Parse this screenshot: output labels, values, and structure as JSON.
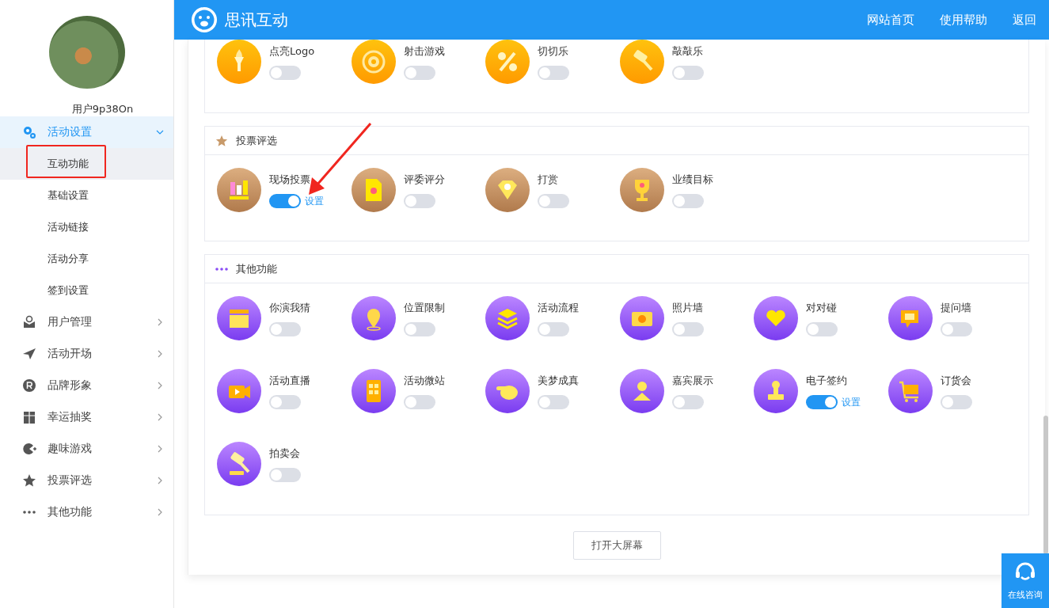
{
  "header": {
    "brand": "思讯互动",
    "links": [
      "网站首页",
      "使用帮助",
      "返回"
    ]
  },
  "sidebar": {
    "username": "用户9p38On",
    "menu": [
      {
        "label": "活动设置",
        "expanded": true,
        "children": [
          {
            "label": "互动功能",
            "selected": true,
            "highlighted": true
          },
          {
            "label": "基础设置",
            "selected": false,
            "highlighted": false
          },
          {
            "label": "活动链接",
            "selected": false,
            "highlighted": false
          },
          {
            "label": "活动分享",
            "selected": false,
            "highlighted": false
          },
          {
            "label": "签到设置",
            "selected": false,
            "highlighted": false
          }
        ]
      },
      {
        "label": "用户管理",
        "expanded": false
      },
      {
        "label": "活动开场",
        "expanded": false
      },
      {
        "label": "品牌形象",
        "expanded": false
      },
      {
        "label": "幸运抽奖",
        "expanded": false
      },
      {
        "label": "趣味游戏",
        "expanded": false
      },
      {
        "label": "投票评选",
        "expanded": false
      },
      {
        "label": "其他功能",
        "expanded": false
      }
    ]
  },
  "sections": [
    {
      "kind": "game",
      "items": [
        {
          "label": "点亮Logo",
          "on": false,
          "arrow": false
        },
        {
          "label": "射击游戏",
          "on": false,
          "arrow": false
        },
        {
          "label": "切切乐",
          "on": false,
          "arrow": false
        },
        {
          "label": "敲敲乐",
          "on": false,
          "arrow": false
        }
      ]
    },
    {
      "kind": "vote",
      "title": "投票评选",
      "items": [
        {
          "label": "现场投票",
          "on": true,
          "link": "设置",
          "arrow": true
        },
        {
          "label": "评委评分",
          "on": false,
          "arrow": false
        },
        {
          "label": "打赏",
          "on": false,
          "arrow": false
        },
        {
          "label": "业绩目标",
          "on": false,
          "arrow": false
        }
      ]
    },
    {
      "kind": "other",
      "title": "其他功能",
      "items": [
        {
          "label": "你演我猜",
          "on": false,
          "arrow": false
        },
        {
          "label": "位置限制",
          "on": false,
          "arrow": false
        },
        {
          "label": "活动流程",
          "on": false,
          "arrow": false
        },
        {
          "label": "照片墙",
          "on": false,
          "arrow": false
        },
        {
          "label": "对对碰",
          "on": false,
          "arrow": false
        },
        {
          "label": "提问墙",
          "on": false,
          "arrow": false
        },
        {
          "label": "活动直播",
          "on": false,
          "arrow": false
        },
        {
          "label": "活动微站",
          "on": false,
          "arrow": false
        },
        {
          "label": "美梦成真",
          "on": false,
          "arrow": false
        },
        {
          "label": "嘉宾展示",
          "on": false,
          "arrow": false
        },
        {
          "label": "电子签约",
          "on": true,
          "link": "设置",
          "arrow": false
        },
        {
          "label": "订货会",
          "on": false,
          "arrow": false
        },
        {
          "label": "拍卖会",
          "on": false,
          "arrow": false
        }
      ]
    }
  ],
  "open_button": "打开大屏幕",
  "support": {
    "label": "在线咨询"
  }
}
